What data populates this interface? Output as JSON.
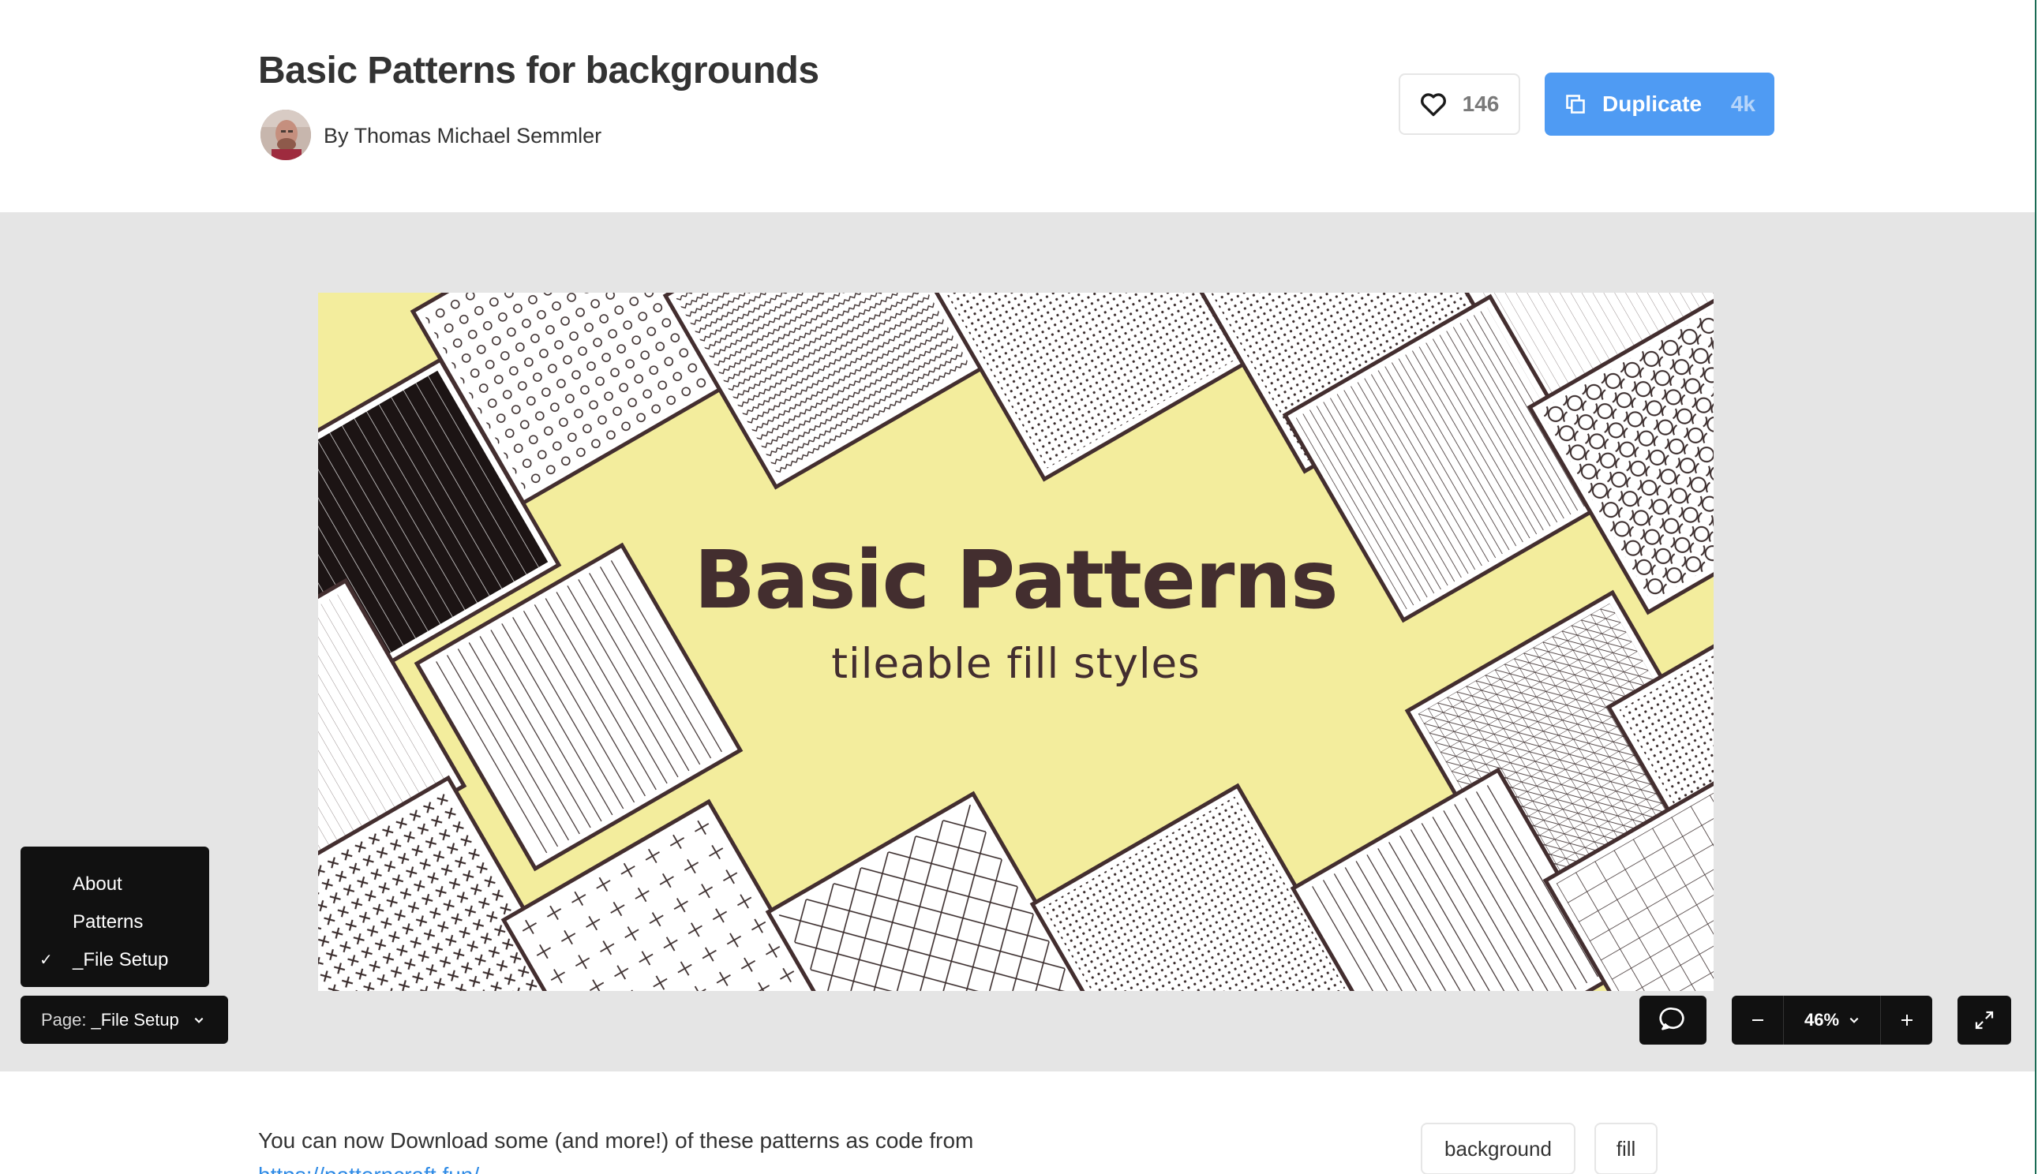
{
  "header": {
    "title": "Basic Patterns for backgrounds",
    "byline": "By Thomas Michael Semmler",
    "like_count": "146",
    "duplicate_label": "Duplicate",
    "duplicate_count": "4k"
  },
  "canvas": {
    "hero_title": "Basic Patterns",
    "hero_subtitle": "tileable fill styles",
    "background_color": "#f3ed9d",
    "ink_color": "#432e2f"
  },
  "page_menu": {
    "items": [
      {
        "label": "About",
        "selected": false
      },
      {
        "label": "Patterns",
        "selected": false
      },
      {
        "label": "_File Setup",
        "selected": true
      }
    ],
    "select_prefix": "Page:",
    "select_value": "_File Setup"
  },
  "controls": {
    "zoom_value": "46%",
    "icons": [
      "comment-icon",
      "minus-icon",
      "chevron-down-icon",
      "plus-icon",
      "fullscreen-icon"
    ]
  },
  "description": {
    "text": "You can now Download some (and more!) of these patterns as code from",
    "link": "https://patterncraft.fun/"
  },
  "tags": [
    "background",
    "fill"
  ],
  "colors": {
    "accent": "#4f9bf3",
    "viewer_bg": "#e5e5e5",
    "dark_control": "#111111"
  }
}
